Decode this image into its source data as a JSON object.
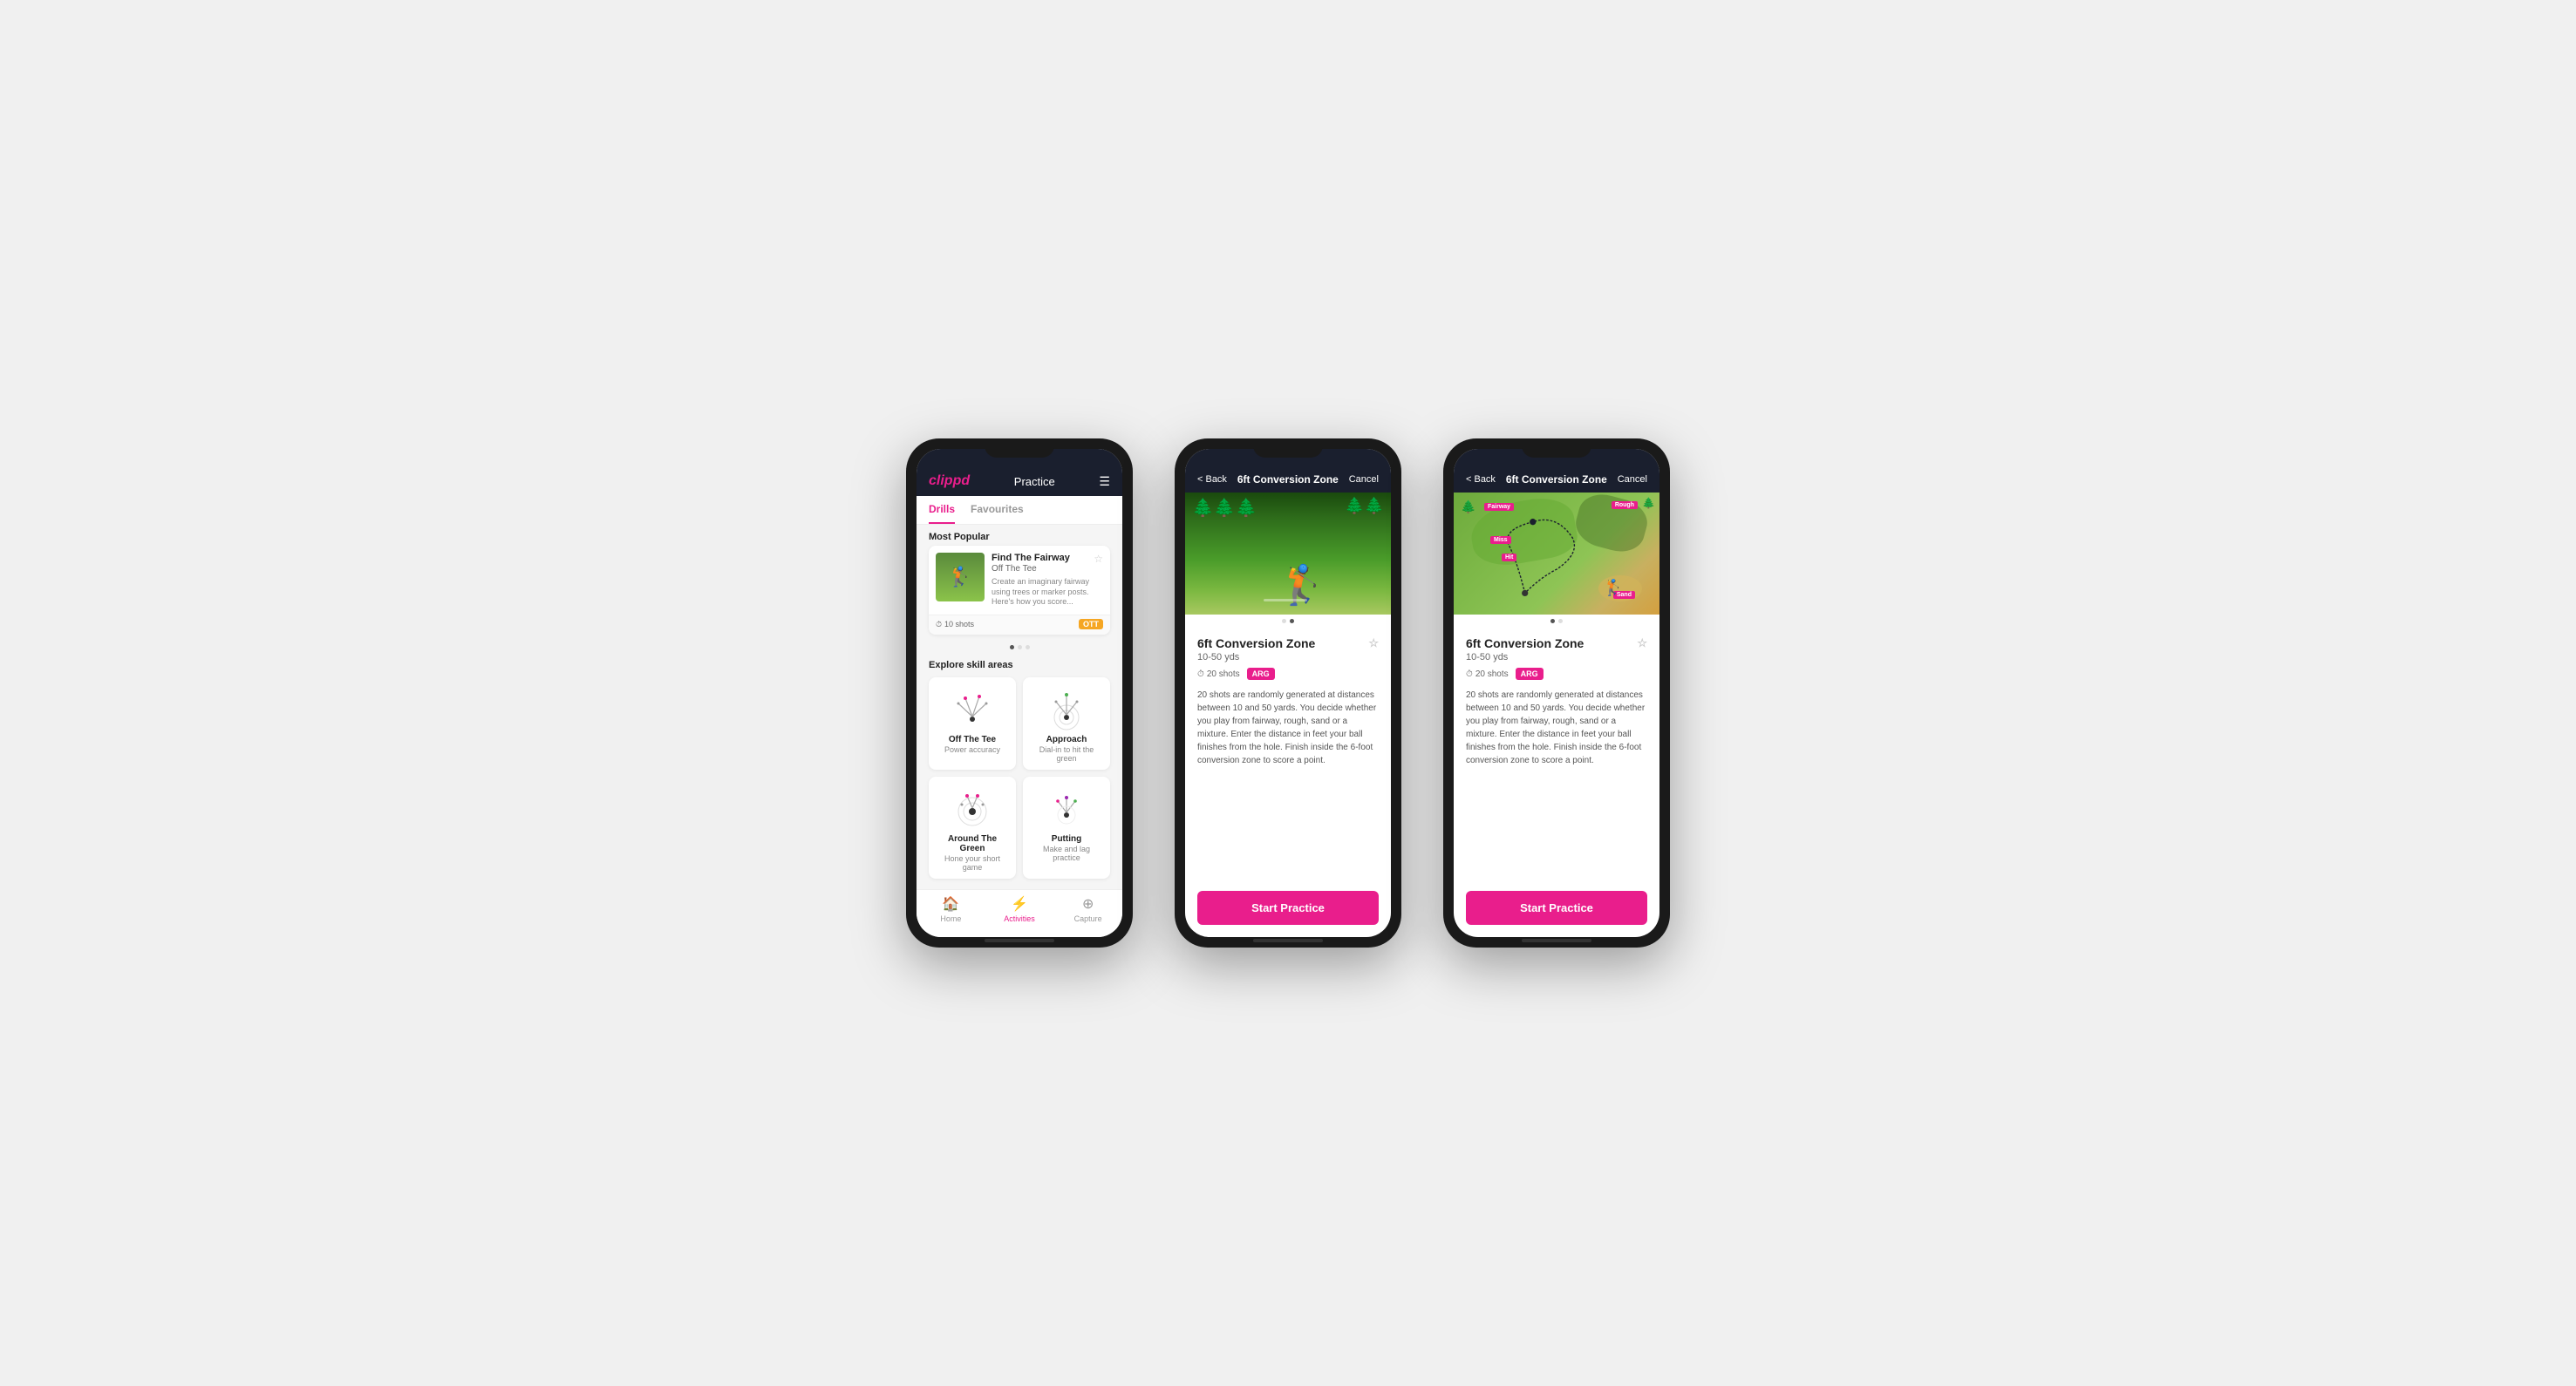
{
  "phones": [
    {
      "id": "phone1",
      "type": "practice-list",
      "header": {
        "logo": "clippd",
        "title": "Practice",
        "menu_icon": "☰"
      },
      "tabs": [
        {
          "label": "Drills",
          "active": true
        },
        {
          "label": "Favourites",
          "active": false
        }
      ],
      "most_popular_label": "Most Popular",
      "featured_card": {
        "title": "Find The Fairway",
        "subtitle": "Off The Tee",
        "description": "Create an imaginary fairway using trees or marker posts. Here's how you score...",
        "shots": "10 shots",
        "tag": "OTT"
      },
      "dots": [
        "active",
        "inactive",
        "inactive"
      ],
      "explore_label": "Explore skill areas",
      "skill_areas": [
        {
          "name": "Off The Tee",
          "sub": "Power accuracy",
          "icon": "ott"
        },
        {
          "name": "Approach",
          "sub": "Dial-in to hit the green",
          "icon": "approach"
        },
        {
          "name": "Around The Green",
          "sub": "Hone your short game",
          "icon": "atg"
        },
        {
          "name": "Putting",
          "sub": "Make and lag practice",
          "icon": "putting"
        }
      ],
      "nav": [
        {
          "label": "Home",
          "icon": "🏠",
          "active": false
        },
        {
          "label": "Activities",
          "icon": "⚡",
          "active": true
        },
        {
          "label": "Capture",
          "icon": "⊕",
          "active": false
        }
      ]
    },
    {
      "id": "phone2",
      "type": "detail-photo",
      "header": {
        "back_label": "< Back",
        "title": "6ft Conversion Zone",
        "cancel_label": "Cancel"
      },
      "dots": [
        "inactive",
        "active"
      ],
      "drill": {
        "title": "6ft Conversion Zone",
        "range": "10-50 yds",
        "shots": "20 shots",
        "tag": "ARG",
        "description": "20 shots are randomly generated at distances between 10 and 50 yards. You decide whether you play from fairway, rough, sand or a mixture. Enter the distance in feet your ball finishes from the hole. Finish inside the 6-foot conversion zone to score a point.",
        "start_label": "Start Practice"
      }
    },
    {
      "id": "phone3",
      "type": "detail-map",
      "header": {
        "back_label": "< Back",
        "title": "6ft Conversion Zone",
        "cancel_label": "Cancel"
      },
      "dots": [
        "active",
        "inactive"
      ],
      "drill": {
        "title": "6ft Conversion Zone",
        "range": "10-50 yds",
        "shots": "20 shots",
        "tag": "ARG",
        "description": "20 shots are randomly generated at distances between 10 and 50 yards. You decide whether you play from fairway, rough, sand or a mixture. Enter the distance in feet your ball finishes from the hole. Finish inside the 6-foot conversion zone to score a point.",
        "start_label": "Start Practice"
      },
      "map_labels": [
        "Fairway",
        "Rough",
        "Miss",
        "Hit",
        "Sand"
      ]
    }
  ]
}
